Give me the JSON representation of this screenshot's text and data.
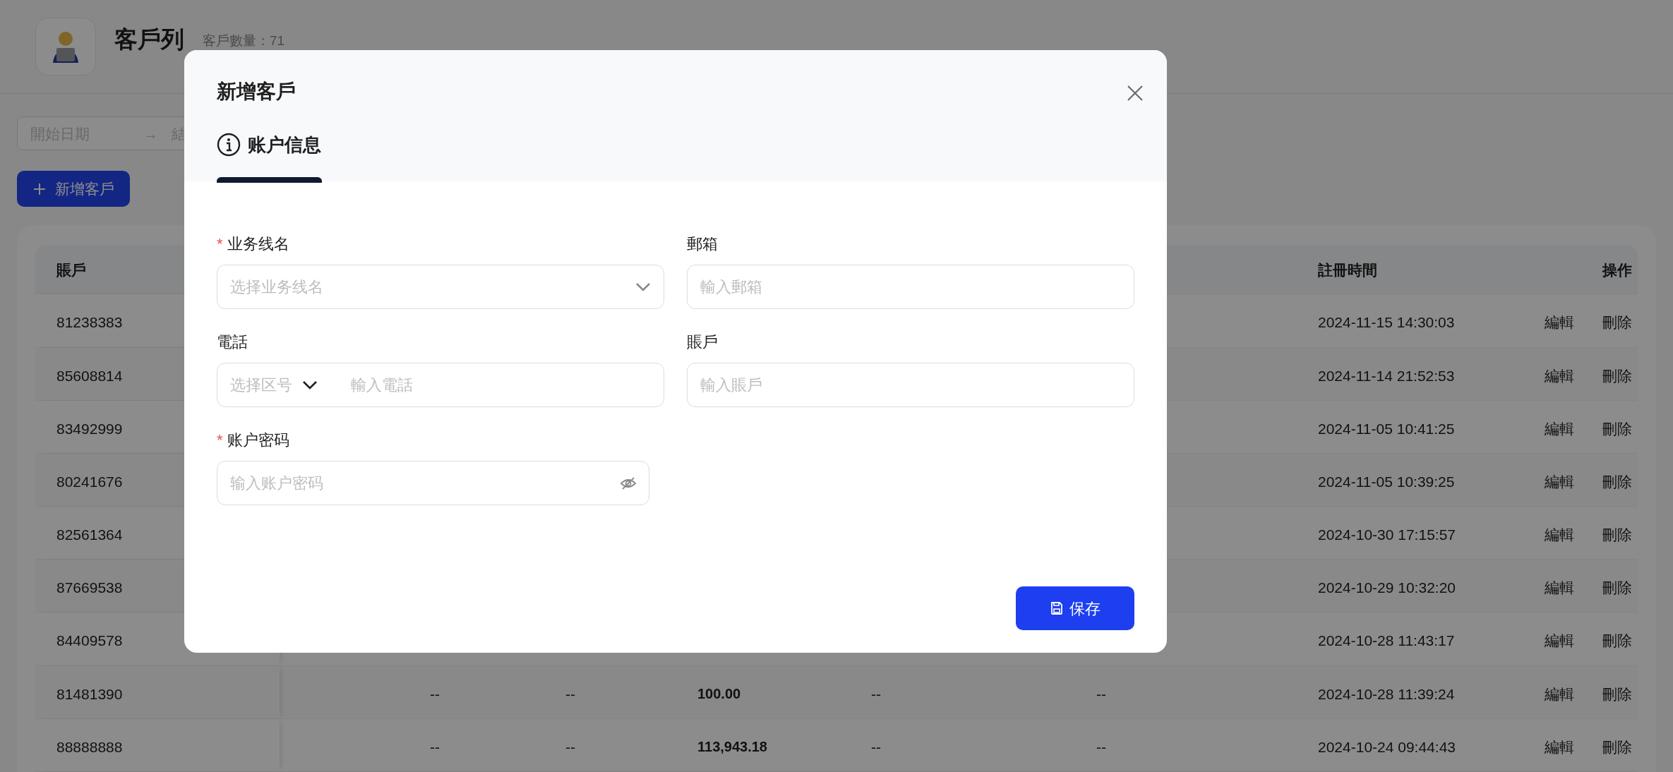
{
  "header": {
    "title": "客戶列",
    "count": "客戶數量：71"
  },
  "date_range": {
    "start_placeholder": "開始日期",
    "separator": "→",
    "end_placeholder": "結"
  },
  "add_button": {
    "label": "新增客戶"
  },
  "table": {
    "columns": {
      "account": "賬戶",
      "registered": "註冊時間",
      "actions": "操作"
    },
    "rows": [
      {
        "account": "81238383",
        "registered": "2024-11-15 14:30:03",
        "actions": [
          "編輯",
          "刪除"
        ]
      },
      {
        "account": "85608814",
        "registered": "2024-11-14 21:52:53",
        "actions": [
          "編輯",
          "刪除"
        ]
      },
      {
        "account": "83492999",
        "registered": "2024-11-05 10:41:25",
        "actions": [
          "編輯",
          "刪除"
        ]
      },
      {
        "account": "80241676",
        "registered": "2024-11-05 10:39:25",
        "actions": [
          "編輯",
          "刪除"
        ]
      },
      {
        "account": "82561364",
        "registered": "2024-10-30 17:15:57",
        "actions": [
          "編輯",
          "刪除"
        ]
      },
      {
        "account": "87669538",
        "registered": "2024-10-29 10:32:20",
        "actions": [
          "編輯",
          "刪除"
        ]
      },
      {
        "account": "84409578",
        "registered": "2024-10-28 11:43:17",
        "actions": [
          "編輯",
          "刪除"
        ]
      },
      {
        "account": "81481390",
        "cells": [
          "--",
          "--",
          "100.00",
          "--",
          "--"
        ],
        "registered": "2024-10-28 11:39:24",
        "actions": [
          "編輯",
          "刪除"
        ]
      },
      {
        "account": "88888888",
        "cells": [
          "--",
          "--",
          "113,943.18",
          "--",
          "--"
        ],
        "registered": "2024-10-24 09:44:43",
        "actions": [
          "編輯",
          "刪除"
        ]
      }
    ]
  },
  "dialog": {
    "title": "新增客戶",
    "tabs": [
      {
        "label": "账户信息",
        "selected": true
      }
    ],
    "fields": [
      {
        "kind": "select",
        "required_mark": "*",
        "label": "业务线名",
        "placeholder": "选择业务线名"
      },
      {
        "kind": "text",
        "label": "郵箱",
        "placeholder": "輸入郵箱"
      },
      {
        "kind": "phone",
        "label": "電話",
        "prefix_placeholder": "选择区号",
        "placeholder": "輸入電話"
      },
      {
        "kind": "text",
        "label": "賬戶",
        "placeholder": "輸入賬戶"
      },
      {
        "kind": "password",
        "required_mark": "*",
        "label": "账户密码",
        "placeholder": "输入账户密码"
      }
    ],
    "save_button": "保存"
  }
}
